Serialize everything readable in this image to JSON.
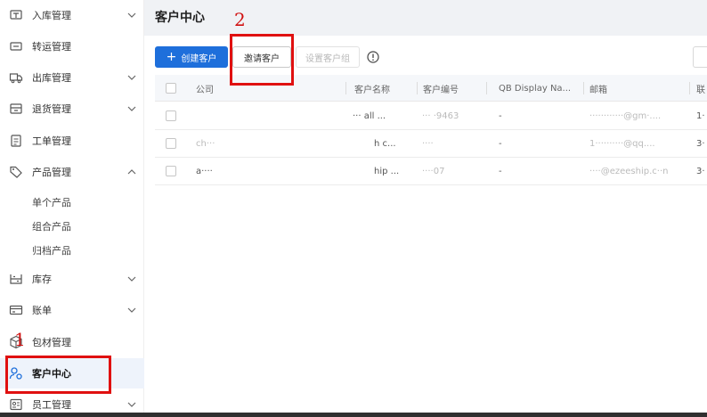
{
  "sidebar": {
    "items": [
      {
        "label": "入库管理",
        "icon": "inbound-icon",
        "chevron": "down"
      },
      {
        "label": "转运管理",
        "icon": "transfer-icon",
        "chevron": ""
      },
      {
        "label": "出库管理",
        "icon": "outbound-truck-icon",
        "chevron": "down"
      },
      {
        "label": "退货管理",
        "icon": "returns-icon",
        "chevron": "down"
      },
      {
        "label": "工单管理",
        "icon": "work-order-icon",
        "chevron": ""
      },
      {
        "label": "产品管理",
        "icon": "tag-icon",
        "chevron": "up"
      },
      {
        "label": "库存",
        "icon": "inventory-icon",
        "chevron": "down"
      },
      {
        "label": "账单",
        "icon": "bill-icon",
        "chevron": "down"
      },
      {
        "label": "包材管理",
        "icon": "package-icon",
        "chevron": ""
      },
      {
        "label": "客户中心",
        "icon": "customer-icon",
        "chevron": ""
      },
      {
        "label": "员工管理",
        "icon": "staff-icon",
        "chevron": "down"
      }
    ],
    "product_subitems": [
      {
        "label": "单个产品"
      },
      {
        "label": "组合产品"
      },
      {
        "label": "归档产品"
      }
    ]
  },
  "main": {
    "title": "客户中心",
    "toolbar": {
      "create_label": "创建客户",
      "create_plus": "+",
      "invite_label": "邀请客户",
      "group_label": "设置客户组"
    },
    "table": {
      "headers": [
        "公司",
        "客户名称",
        "客户编号",
        "QB Display Na...",
        "邮箱",
        "联"
      ],
      "rows": [
        {
          "company": "",
          "name": "··· all ...",
          "code": "··· ·9463",
          "qb": "-",
          "email": "············@gm·....",
          "phone": "1·"
        },
        {
          "company": "ch···",
          "name": "h c...",
          "code": "····",
          "qb": "-",
          "email": "1··········@qq....",
          "phone": "3·"
        },
        {
          "company": "a····",
          "name": "hip ...",
          "code": "····07",
          "qb": "-",
          "email": "····@ezeeship.c··n",
          "phone": "3·"
        }
      ]
    }
  },
  "annotations": {
    "box1_number": "1",
    "box2_number": "2",
    "color": "#e01010"
  },
  "colors": {
    "primary": "#1e6fdb",
    "active_bg": "#eef3fb"
  }
}
